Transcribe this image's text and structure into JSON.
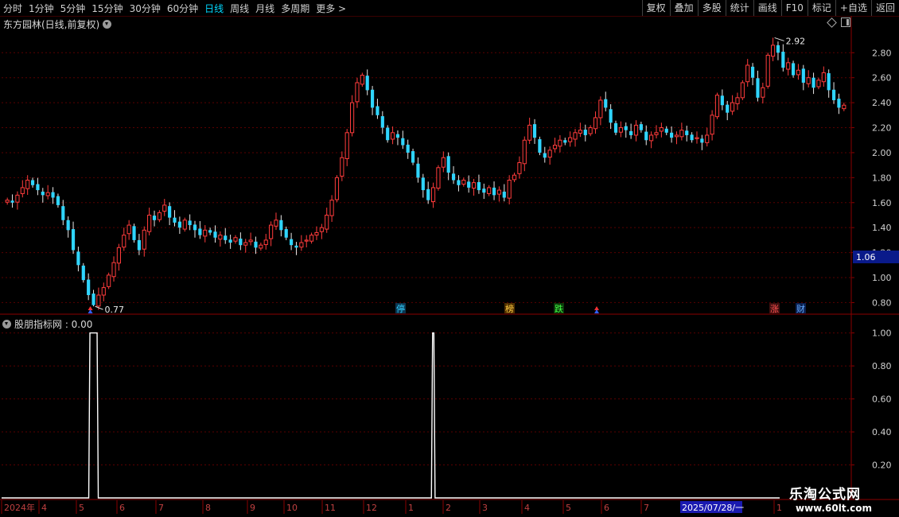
{
  "toolbar": {
    "periods": [
      "分时",
      "1分钟",
      "5分钟",
      "15分钟",
      "30分钟",
      "60分钟",
      "日线",
      "周线",
      "月线",
      "多周期",
      "更多 >"
    ],
    "active_period": "日线",
    "right_buttons": [
      "复权",
      "叠加",
      "多股",
      "统计",
      "画线",
      "F10",
      "标记",
      "+自选",
      "返回"
    ]
  },
  "chart_title": "东方园林(日线,前复权)",
  "indicator_title": "股朋指标网 : 0.00",
  "price_axis": [
    "2.80",
    "2.60",
    "2.40",
    "2.20",
    "2.00",
    "1.80",
    "1.60",
    "1.40",
    "1.20",
    "1.00",
    "0.80"
  ],
  "current_price_tag": "1.06",
  "high_label": "2.92",
  "low_label": "0.77",
  "indicator_axis": [
    "1.00",
    "0.80",
    "0.60",
    "0.40",
    "0.20"
  ],
  "event_tags": [
    {
      "text": "停",
      "color": "#33d0ff",
      "bg": "#0a3650"
    },
    {
      "text": "榜",
      "color": "#ffcc44",
      "bg": "#503000"
    },
    {
      "text": "跌",
      "color": "#44ff44",
      "bg": "#0a3a0a"
    },
    {
      "text": "涨",
      "color": "#ff5050",
      "bg": "#401010"
    },
    {
      "text": "财",
      "color": "#66aaff",
      "bg": "#0a2050"
    }
  ],
  "date_axis": [
    "2024年",
    "4",
    "5",
    "6",
    "7",
    "8",
    "9",
    "10",
    "11",
    "12",
    "1",
    "2",
    "3",
    "4",
    "5",
    "6",
    "7",
    "2025/07/28/一",
    "1"
  ],
  "watermark": {
    "cn": "乐淘公式网",
    "url": "www.60lt.com"
  },
  "chart_data": {
    "type": "candlestick",
    "title": "东方园林(日线,前复权)",
    "price_ylim": [
      0.72,
      2.98
    ],
    "high": 2.92,
    "low": 0.77,
    "close": [
      1.62,
      1.6,
      1.66,
      1.72,
      1.78,
      1.74,
      1.7,
      1.66,
      1.68,
      1.64,
      1.58,
      1.46,
      1.38,
      1.22,
      1.1,
      0.98,
      0.86,
      0.78,
      0.86,
      0.92,
      1.02,
      1.12,
      1.24,
      1.34,
      1.42,
      1.3,
      1.22,
      1.38,
      1.5,
      1.46,
      1.52,
      1.58,
      1.48,
      1.44,
      1.4,
      1.46,
      1.42,
      1.38,
      1.34,
      1.38,
      1.36,
      1.32,
      1.34,
      1.3,
      1.28,
      1.32,
      1.26,
      1.28,
      1.3,
      1.24,
      1.26,
      1.3,
      1.42,
      1.46,
      1.38,
      1.32,
      1.26,
      1.24,
      1.28,
      1.3,
      1.34,
      1.36,
      1.4,
      1.5,
      1.62,
      1.8,
      1.96,
      2.16,
      2.4,
      2.56,
      2.62,
      2.5,
      2.36,
      2.3,
      2.2,
      2.1,
      2.16,
      2.12,
      2.06,
      2.0,
      1.92,
      1.8,
      1.7,
      1.62,
      1.72,
      1.88,
      1.96,
      1.84,
      1.78,
      1.74,
      1.78,
      1.72,
      1.76,
      1.7,
      1.68,
      1.72,
      1.66,
      1.7,
      1.64,
      1.78,
      1.82,
      1.92,
      2.1,
      2.22,
      2.12,
      2.0,
      1.96,
      2.02,
      2.06,
      2.1,
      2.08,
      2.12,
      2.16,
      2.18,
      2.14,
      2.2,
      2.28,
      2.42,
      2.36,
      2.24,
      2.16,
      2.2,
      2.18,
      2.14,
      2.22,
      2.18,
      2.1,
      2.14,
      2.16,
      2.2,
      2.16,
      2.12,
      2.14,
      2.18,
      2.14,
      2.1,
      2.12,
      2.08,
      2.14,
      2.3,
      2.46,
      2.38,
      2.32,
      2.4,
      2.44,
      2.56,
      2.7,
      2.6,
      2.44,
      2.52,
      2.78,
      2.86,
      2.8,
      2.68,
      2.72,
      2.62,
      2.66,
      2.56,
      2.6,
      2.52,
      2.58,
      2.64,
      2.5,
      2.42,
      2.36,
      2.38
    ],
    "indicator_signals": [
      {
        "bar": 17,
        "value": 1.0
      },
      {
        "bar": 84,
        "value": 1.0
      }
    ],
    "indicator_ylim": [
      0.0,
      1.08
    ]
  }
}
